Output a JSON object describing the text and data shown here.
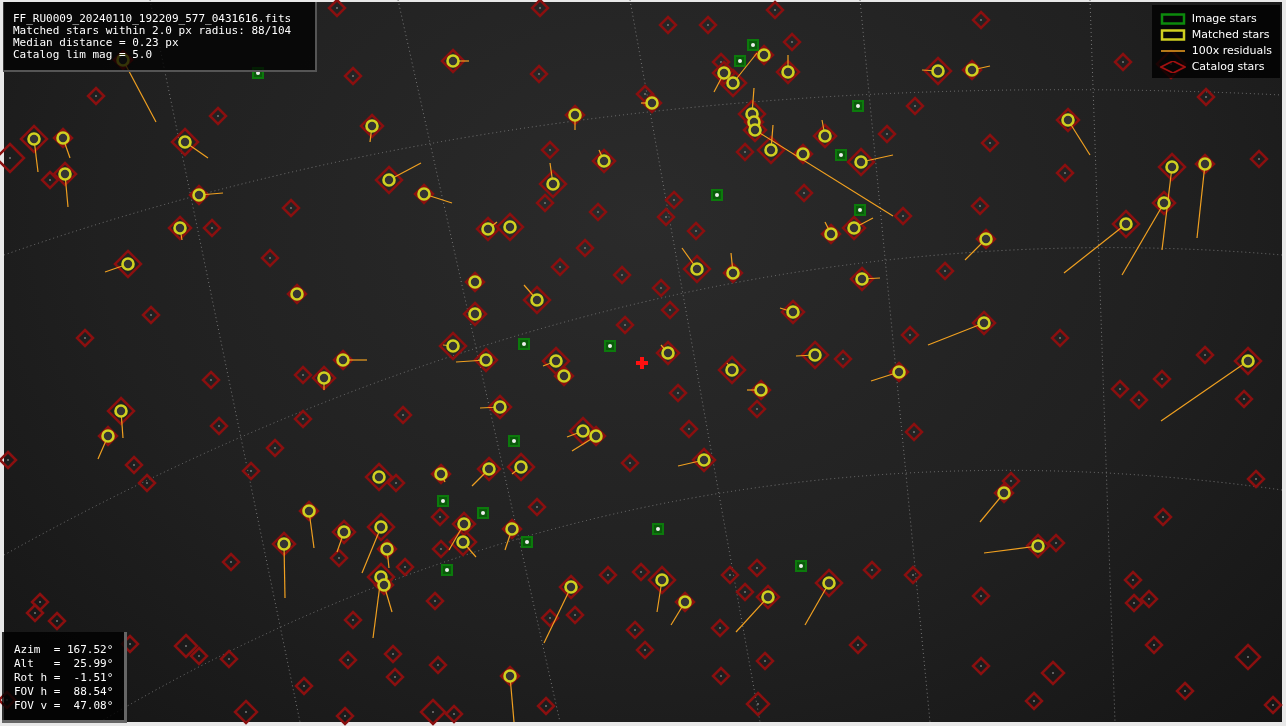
{
  "image_info": {
    "lines": [
      "FF_RU0009_20240110_192209_577_0431616.fits",
      "Matched stars within 2.0 px radius: 88/104",
      "Median distance = 0.23 px",
      "Catalog lim mag = 5.0"
    ]
  },
  "legend": {
    "items": [
      {
        "kind": "image",
        "label": "Image stars"
      },
      {
        "kind": "matched",
        "label": "Matched stars"
      },
      {
        "kind": "residual",
        "label": "100x residuals"
      },
      {
        "kind": "catalog",
        "label": "Catalog stars"
      }
    ]
  },
  "pointing": {
    "lines": [
      "Azim  = 167.52°",
      "Alt   =  25.99°",
      "Rot h =  -1.51°",
      "FOV h =  88.54°",
      "FOV v =  47.08°"
    ]
  }
}
